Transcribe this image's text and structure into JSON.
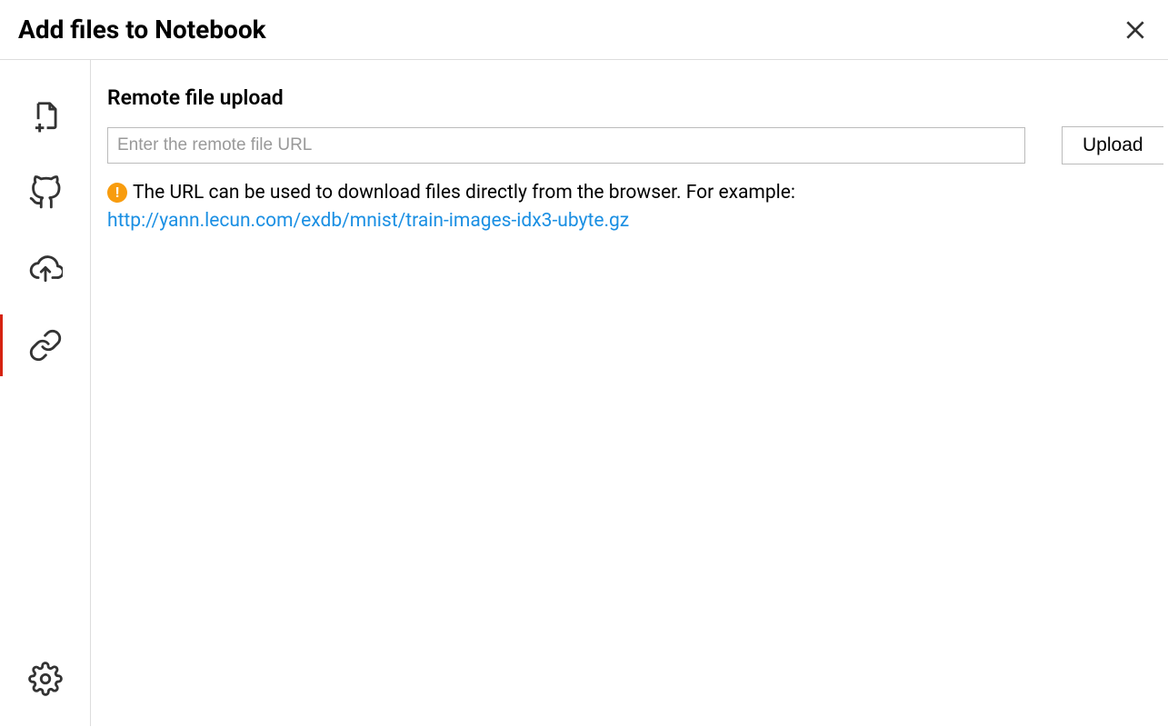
{
  "header": {
    "title": "Add files to Notebook"
  },
  "sidebar": {
    "items": [
      {
        "name": "add-file",
        "active": false
      },
      {
        "name": "github",
        "active": false
      },
      {
        "name": "cloud-upload",
        "active": false
      },
      {
        "name": "link",
        "active": true
      }
    ],
    "bottom": {
      "name": "settings"
    }
  },
  "main": {
    "section_title": "Remote file upload",
    "url_input": {
      "placeholder": "Enter the remote file URL",
      "value": ""
    },
    "upload_button_label": "Upload",
    "info_text": "The URL can be used to download files directly from the browser. For example:",
    "info_link_text": "http://yann.lecun.com/exdb/mnist/train-images-idx3-ubyte.gz"
  }
}
